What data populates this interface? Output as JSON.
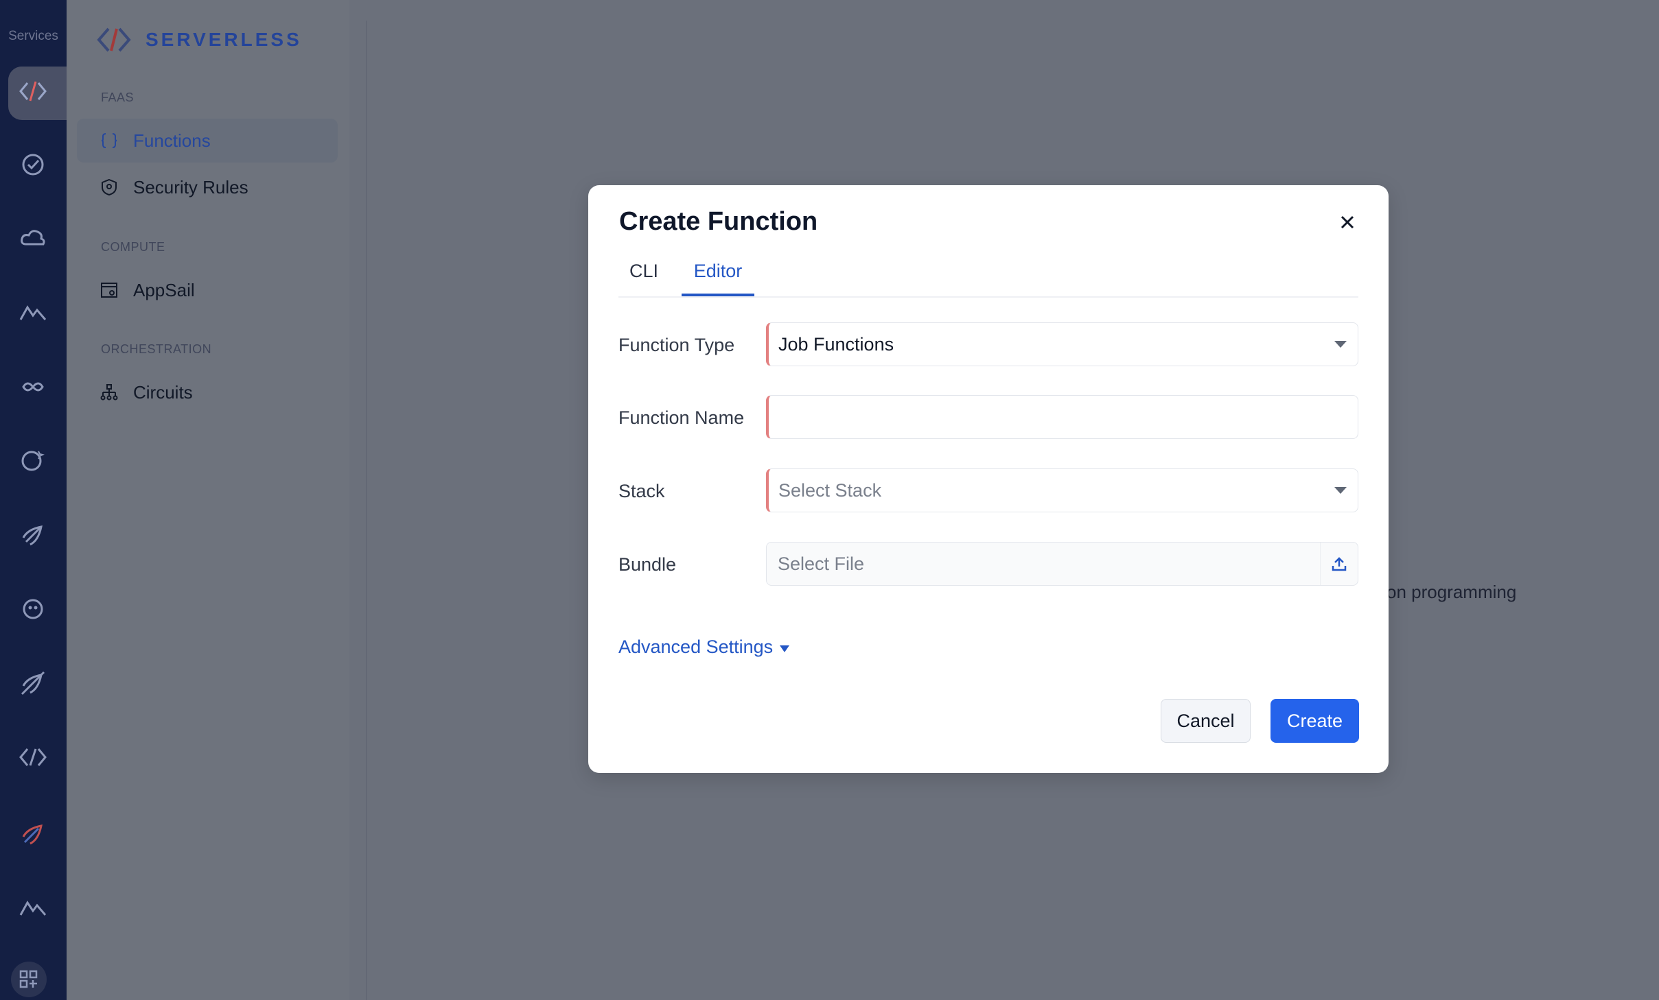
{
  "rail": {
    "title": "Services",
    "items": [
      {
        "icon": "serverless-icon",
        "active": true
      },
      {
        "icon": "check-badge-icon"
      },
      {
        "icon": "cloud-icon"
      },
      {
        "icon": "mountain-icon"
      },
      {
        "icon": "infinity-icon"
      },
      {
        "icon": "chat-star-icon"
      },
      {
        "icon": "rocket-icon"
      },
      {
        "icon": "bot-icon"
      },
      {
        "icon": "rocket-off-icon"
      },
      {
        "icon": "diamond-code-icon"
      },
      {
        "icon": "rocket-red-icon"
      },
      {
        "icon": "mountain-icon-2"
      }
    ],
    "footer_icon": "apps-grid-icon"
  },
  "sidebar": {
    "brand": "SERVERLESS",
    "sections": [
      {
        "label": "FAAS",
        "items": [
          {
            "label": "Functions",
            "icon": "braces-icon",
            "active": true
          },
          {
            "label": "Security Rules",
            "icon": "shield-icon"
          }
        ]
      },
      {
        "label": "COMPUTE",
        "items": [
          {
            "label": "AppSail",
            "icon": "appsail-icon"
          }
        ]
      },
      {
        "label": "ORCHESTRATION",
        "items": [
          {
            "label": "Circuits",
            "icon": "circuit-icon"
          }
        ]
      }
    ]
  },
  "background": {
    "partial_text": "on programming"
  },
  "modal": {
    "title": "Create Function",
    "tabs": [
      {
        "label": "CLI",
        "active": false
      },
      {
        "label": "Editor",
        "active": true
      }
    ],
    "fields": {
      "function_type": {
        "label": "Function Type",
        "value": "Job Functions"
      },
      "function_name": {
        "label": "Function Name",
        "value": ""
      },
      "stack": {
        "label": "Stack",
        "placeholder": "Select Stack"
      },
      "bundle": {
        "label": "Bundle",
        "placeholder": "Select File"
      }
    },
    "advanced_label": "Advanced Settings",
    "cancel_label": "Cancel",
    "create_label": "Create"
  },
  "colors": {
    "accent": "#2563eb",
    "link": "#2457c5",
    "rail_bg": "#141f43",
    "required_marker": "#e38080"
  }
}
